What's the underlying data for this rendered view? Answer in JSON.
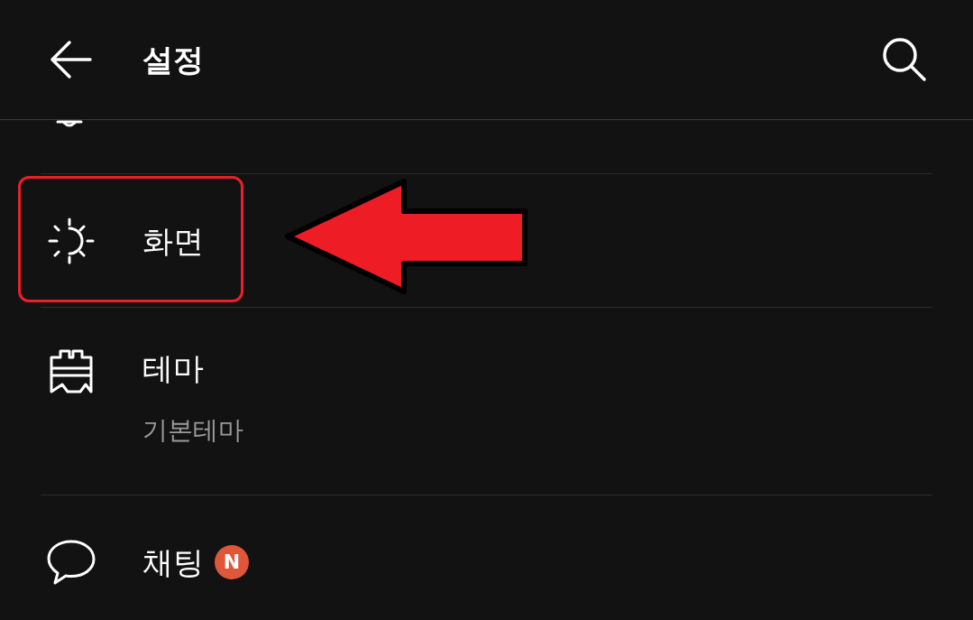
{
  "header": {
    "title": "설정"
  },
  "rows": [
    {
      "kind": "display",
      "title": "화면",
      "highlighted": true
    },
    {
      "kind": "theme",
      "title": "테마",
      "subtitle": "기본테마",
      "highlighted": false
    },
    {
      "kind": "chat",
      "title": "채팅",
      "badge": "N",
      "highlighted": false
    }
  ]
}
